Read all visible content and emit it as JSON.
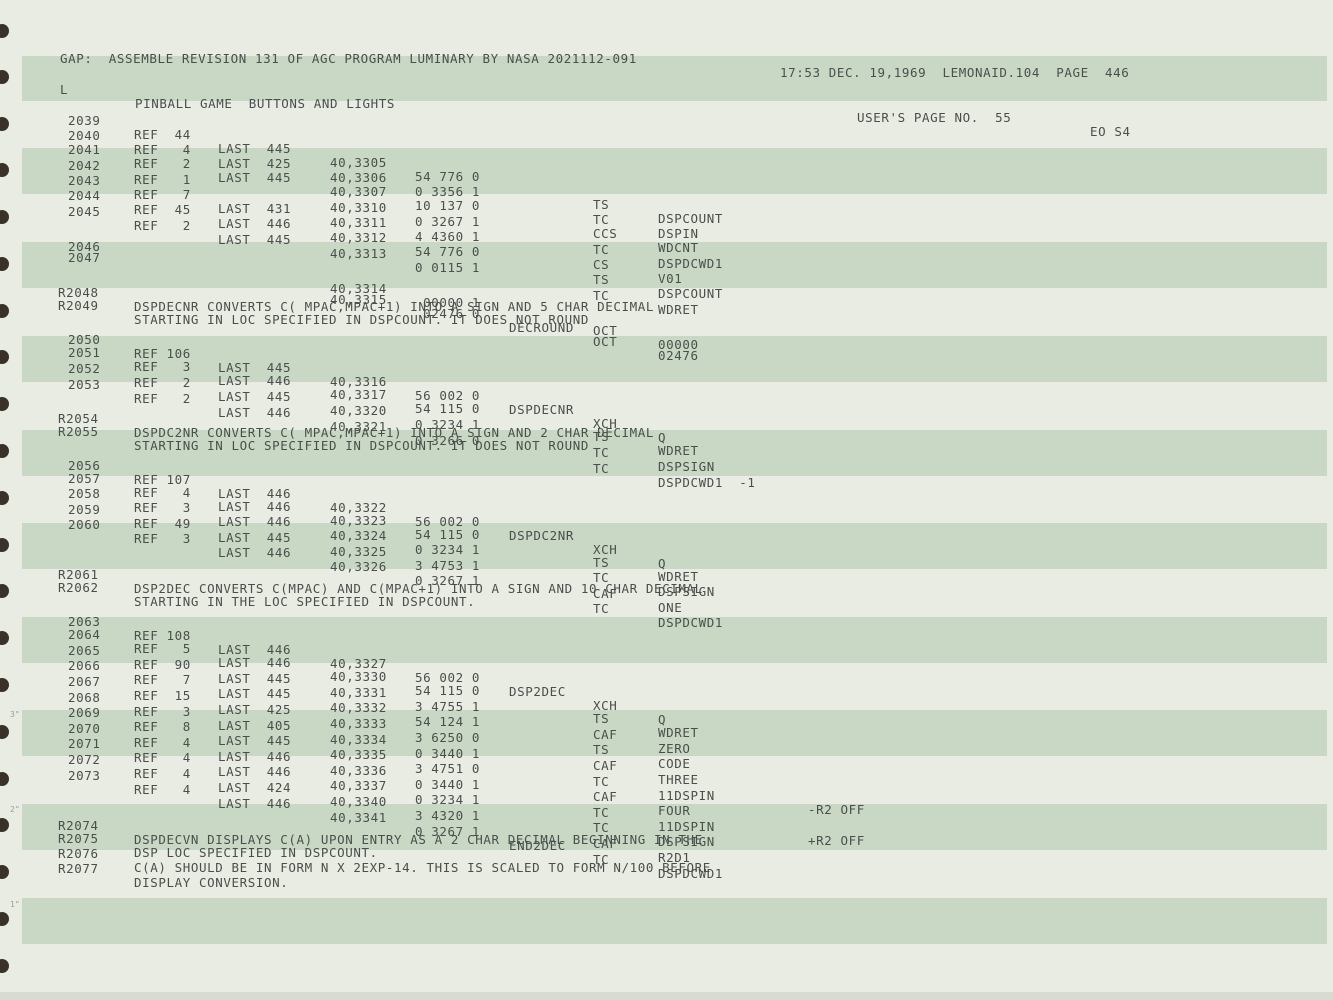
{
  "header": {
    "left": "GAP:  ASSEMBLE REVISION 131 OF AGC PROGRAM LUMINARY BY NASA 2021112-091",
    "right": "17:53 DEC. 19,1969  LEMONAID.104  PAGE  446"
  },
  "subheader": {
    "flag": "L",
    "title": "PINBALL GAME  BUTTONS AND LIGHTS",
    "page_label": "USER'S PAGE NO.  55",
    "code": "EO S4"
  },
  "lines": [
    {
      "no": "2039",
      "ref": "REF  44",
      "last": "LAST  445",
      "addr": "40,3305",
      "word": "54 776 0",
      "label": "",
      "op": "TS",
      "operand": "DSPCOUNT",
      "comment": ""
    },
    {
      "no": "2040",
      "ref": "REF   4",
      "last": "LAST  425",
      "addr": "40,3306",
      "word": "0 3356 1",
      "label": "",
      "op": "TC",
      "operand": "DSPIN",
      "comment": ""
    },
    {
      "no": "2041",
      "ref": "REF   2",
      "last": "LAST  445",
      "addr": "40,3307",
      "word": "10 137 0",
      "label": "",
      "op": "CCS",
      "operand": "WDCNT",
      "comment": ""
    },
    {
      "no": "2042",
      "ref": "REF   1",
      "last": "",
      "addr": "40,3310",
      "word": "0 3267 1",
      "label": "",
      "op": "TC",
      "operand": "DSPDCWD1",
      "comment": ""
    },
    {
      "no": "2043",
      "ref": "REF   7",
      "last": "LAST  431",
      "addr": "40,3311",
      "word": "4 4360 1",
      "label": "",
      "op": "CS",
      "operand": "V01",
      "comment": ""
    },
    {
      "no": "2044",
      "ref": "REF  45",
      "last": "LAST  446",
      "addr": "40,3312",
      "word": "54 776 0",
      "label": "",
      "op": "TS",
      "operand": "DSPCOUNT",
      "comment": ""
    },
    {
      "no": "2045",
      "ref": "REF   2",
      "last": "LAST  445",
      "addr": "40,3313",
      "word": "0 0115 1",
      "label": "",
      "op": "TC",
      "operand": "WDRET",
      "comment": ""
    },
    {
      "no": "2046",
      "ref": "",
      "last": "",
      "addr": "40,3314",
      "word": " 00000 1",
      "label": "",
      "op": "OCT",
      "operand": "00000",
      "comment": ""
    },
    {
      "no": "2047",
      "ref": "",
      "last": "",
      "addr": "40,3315",
      "word": " 02476 0",
      "label": "DECROUND",
      "op": "OCT",
      "operand": "02476",
      "comment": ""
    },
    {
      "no": "2050",
      "ref": "REF 106",
      "last": "LAST  445",
      "addr": "40,3316",
      "word": "56 002 0",
      "label": "DSPDECNR",
      "op": "XCH",
      "operand": "Q",
      "comment": ""
    },
    {
      "no": "2051",
      "ref": "REF   3",
      "last": "LAST  446",
      "addr": "40,3317",
      "word": "54 115 0",
      "label": "",
      "op": "TS",
      "operand": "WDRET",
      "comment": ""
    },
    {
      "no": "2052",
      "ref": "REF   2",
      "last": "LAST  445",
      "addr": "40,3320",
      "word": "0 3234 1",
      "label": "",
      "op": "TC",
      "operand": "DSPSIGN",
      "comment": ""
    },
    {
      "no": "2053",
      "ref": "REF   2",
      "last": "LAST  446",
      "addr": "40,3321",
      "word": "0 3266 0",
      "label": "",
      "op": "TC",
      "operand": "DSPDCWD1  -1",
      "comment": ""
    },
    {
      "no": "2056",
      "ref": "REF 107",
      "last": "LAST  446",
      "addr": "40,3322",
      "word": "56 002 0",
      "label": "DSPDC2NR",
      "op": "XCH",
      "operand": "Q",
      "comment": ""
    },
    {
      "no": "2057",
      "ref": "REF   4",
      "last": "LAST  446",
      "addr": "40,3323",
      "word": "54 115 0",
      "label": "",
      "op": "TS",
      "operand": "WDRET",
      "comment": ""
    },
    {
      "no": "2058",
      "ref": "REF   3",
      "last": "LAST  446",
      "addr": "40,3324",
      "word": "0 3234 1",
      "label": "",
      "op": "TC",
      "operand": "DSPSIGN",
      "comment": ""
    },
    {
      "no": "2059",
      "ref": "REF  49",
      "last": "LAST  445",
      "addr": "40,3325",
      "word": "3 4753 1",
      "label": "",
      "op": "CAF",
      "operand": "ONE",
      "comment": ""
    },
    {
      "no": "2060",
      "ref": "REF   3",
      "last": "LAST  446",
      "addr": "40,3326",
      "word": "0 3267 1",
      "label": "",
      "op": "TC",
      "operand": "DSPDCWD1",
      "comment": ""
    },
    {
      "no": "2063",
      "ref": "REF 108",
      "last": "LAST  446",
      "addr": "40,3327",
      "word": "56 002 0",
      "label": "DSP2DEC",
      "op": "XCH",
      "operand": "Q",
      "comment": ""
    },
    {
      "no": "2064",
      "ref": "REF   5",
      "last": "LAST  446",
      "addr": "40,3330",
      "word": "54 115 0",
      "label": "",
      "op": "TS",
      "operand": "WDRET",
      "comment": ""
    },
    {
      "no": "2065",
      "ref": "REF  90",
      "last": "LAST  445",
      "addr": "40,3331",
      "word": "3 4755 1",
      "label": "",
      "op": "CAF",
      "operand": "ZERO",
      "comment": ""
    },
    {
      "no": "2066",
      "ref": "REF   7",
      "last": "LAST  445",
      "addr": "40,3332",
      "word": "54 124 1",
      "label": "",
      "op": "TS",
      "operand": "CODE",
      "comment": ""
    },
    {
      "no": "2067",
      "ref": "REF  15",
      "last": "LAST  425",
      "addr": "40,3333",
      "word": "3 6250 0",
      "label": "",
      "op": "CAF",
      "operand": "THREE",
      "comment": ""
    },
    {
      "no": "2068",
      "ref": "REF   3",
      "last": "LAST  405",
      "addr": "40,3334",
      "word": "0 3440 1",
      "label": "",
      "op": "TC",
      "operand": "11DSPIN",
      "comment": "-R2 OFF"
    },
    {
      "no": "2069",
      "ref": "REF   8",
      "last": "LAST  445",
      "addr": "40,3335",
      "word": "3 4751 0",
      "label": "",
      "op": "CAF",
      "operand": "FOUR",
      "comment": ""
    },
    {
      "no": "2070",
      "ref": "REF   4",
      "last": "LAST  446",
      "addr": "40,3336",
      "word": "0 3440 1",
      "label": "",
      "op": "TC",
      "operand": "11DSPIN",
      "comment": "+R2 OFF"
    },
    {
      "no": "2071",
      "ref": "REF   4",
      "last": "LAST  446",
      "addr": "40,3337",
      "word": "0 3234 1",
      "label": "",
      "op": "TC",
      "operand": "DSPSIGN",
      "comment": ""
    },
    {
      "no": "2072",
      "ref": "REF   4",
      "last": "LAST  424",
      "addr": "40,3340",
      "word": "3 4320 1",
      "label": "",
      "op": "CAF",
      "operand": "R2D1",
      "comment": ""
    },
    {
      "no": "2073",
      "ref": "REF   4",
      "last": "LAST  446",
      "addr": "40,3341",
      "word": "0 3267 1",
      "label": "END2DEC",
      "op": "TC",
      "operand": "DSPDCWD1",
      "comment": ""
    }
  ],
  "remarks": [
    {
      "no": "R2048",
      "text": "DSPDECNR CONVERTS C( MPAC,MPAC+1) INTO A SIGN AND 5 CHAR DECIMAL"
    },
    {
      "no": "R2049",
      "text": "STARTING IN LOC SPECIFIED IN DSPCOUNT. IT DOES NOT ROUND"
    },
    {
      "no": "R2054",
      "text": "DSPDC2NR CONVERTS C( MPAC,MPAC+1) INTO A SIGN AND 2 CHAR DECIMAL"
    },
    {
      "no": "R2055",
      "text": "STARTING IN LOC SPECIFIED IN DSPCOUNT. IT DOES NOT ROUND"
    },
    {
      "no": "R2061",
      "text": "DSP2DEC CONVERTS C(MPAC) AND C(MPAC+1) INTO A SIGN AND 10 CHAR DECIMAL"
    },
    {
      "no": "R2062",
      "text": "STARTING IN THE LOC SPECIFIED IN DSPCOUNT."
    },
    {
      "no": "R2074",
      "text": "DSPDECVN DISPLAYS C(A) UPON ENTRY AS A 2 CHAR DECIMAL BEGINNING IN THE"
    },
    {
      "no": "R2075",
      "text": "DSP LOC SPECIFIED IN DSPCOUNT."
    },
    {
      "no": "R2076",
      "text": "C(A) SHOULD BE IN FORM N X 2EXP-14. THIS IS SCALED TO FORM N/100 BEFORE"
    },
    {
      "no": "R2077",
      "text": "DISPLAY CONVERSION."
    }
  ],
  "margin_ticks": [
    "3\"",
    "2\"",
    "1\""
  ]
}
